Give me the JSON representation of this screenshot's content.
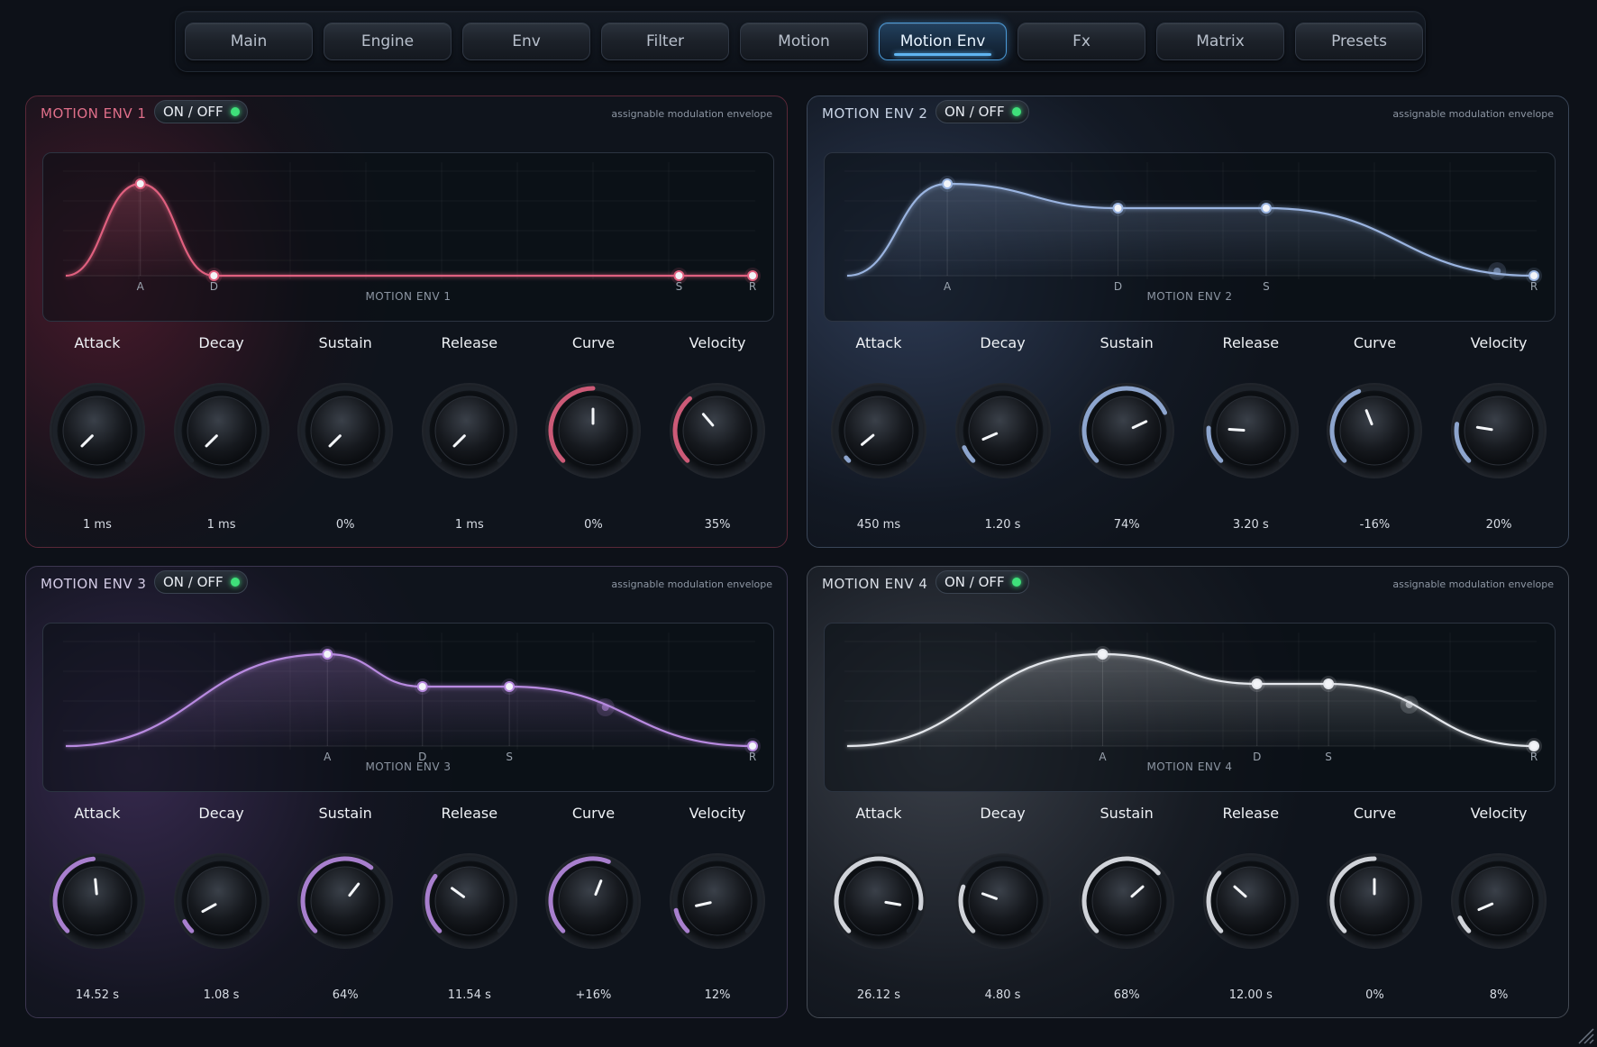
{
  "tabs": [
    {
      "label": "Main",
      "active": false
    },
    {
      "label": "Engine",
      "active": false
    },
    {
      "label": "Env",
      "active": false
    },
    {
      "label": "Filter",
      "active": false
    },
    {
      "label": "Motion",
      "active": false
    },
    {
      "label": "Motion Env",
      "active": true
    },
    {
      "label": "Fx",
      "active": false
    },
    {
      "label": "Matrix",
      "active": false
    },
    {
      "label": "Presets",
      "active": false
    }
  ],
  "panels": [
    {
      "title": "MOTION ENV 1",
      "toggle": "ON / OFF",
      "enabled": true,
      "subtitle": "assignable modulation envelope",
      "graph_label": "MOTION ENV 1",
      "color": "#e0607f",
      "title_color": "#e06f8a",
      "stage_labels": [
        "A",
        "D",
        "S",
        "R"
      ],
      "controls": [
        {
          "label": "Attack",
          "value": "1 ms",
          "level": 0.0
        },
        {
          "label": "Decay",
          "value": "1 ms",
          "level": 0.0
        },
        {
          "label": "Sustain",
          "value": "0%",
          "level": 0.0
        },
        {
          "label": "Release",
          "value": "1 ms",
          "level": 0.0
        },
        {
          "label": "Curve",
          "value": "0%",
          "level": 0.5
        },
        {
          "label": "Velocity",
          "value": "35%",
          "level": 0.35
        }
      ]
    },
    {
      "title": "MOTION ENV 2",
      "toggle": "ON / OFF",
      "enabled": true,
      "subtitle": "assignable modulation envelope",
      "graph_label": "MOTION ENV 2",
      "color": "#9ab4e0",
      "title_color": "#c9d4e6",
      "stage_labels": [
        "A",
        "D",
        "S",
        "R"
      ],
      "controls": [
        {
          "label": "Attack",
          "value": "450 ms",
          "level": 0.02
        },
        {
          "label": "Decay",
          "value": "1.20 s",
          "level": 0.08
        },
        {
          "label": "Sustain",
          "value": "74%",
          "level": 0.74
        },
        {
          "label": "Release",
          "value": "3.20 s",
          "level": 0.18
        },
        {
          "label": "Curve",
          "value": "-16%",
          "level": 0.42
        },
        {
          "label": "Velocity",
          "value": "20%",
          "level": 0.2
        }
      ]
    },
    {
      "title": "MOTION ENV 3",
      "toggle": "ON / OFF",
      "enabled": true,
      "subtitle": "assignable modulation envelope",
      "graph_label": "MOTION ENV 3",
      "color": "#b88ae0",
      "title_color": "#d4cce6",
      "stage_labels": [
        "A",
        "D",
        "S",
        "R"
      ],
      "controls": [
        {
          "label": "Attack",
          "value": "14.52 s",
          "level": 0.48
        },
        {
          "label": "Decay",
          "value": "1.08 s",
          "level": 0.06
        },
        {
          "label": "Sustain",
          "value": "64%",
          "level": 0.64
        },
        {
          "label": "Release",
          "value": "11.54 s",
          "level": 0.3
        },
        {
          "label": "Curve",
          "value": "+16%",
          "level": 0.58
        },
        {
          "label": "Velocity",
          "value": "12%",
          "level": 0.12
        }
      ]
    },
    {
      "title": "MOTION ENV 4",
      "toggle": "ON / OFF",
      "enabled": true,
      "subtitle": "assignable modulation envelope",
      "graph_label": "MOTION ENV 4",
      "color": "#e4e7ec",
      "title_color": "#d8dde5",
      "stage_labels": [
        "A",
        "D",
        "S",
        "R"
      ],
      "controls": [
        {
          "label": "Attack",
          "value": "26.12 s",
          "level": 0.87
        },
        {
          "label": "Decay",
          "value": "4.80 s",
          "level": 0.24
        },
        {
          "label": "Sustain",
          "value": "68%",
          "level": 0.68
        },
        {
          "label": "Release",
          "value": "12.00 s",
          "level": 0.32
        },
        {
          "label": "Curve",
          "value": "0%",
          "level": 0.5
        },
        {
          "label": "Velocity",
          "value": "8%",
          "level": 0.08
        }
      ]
    }
  ]
}
